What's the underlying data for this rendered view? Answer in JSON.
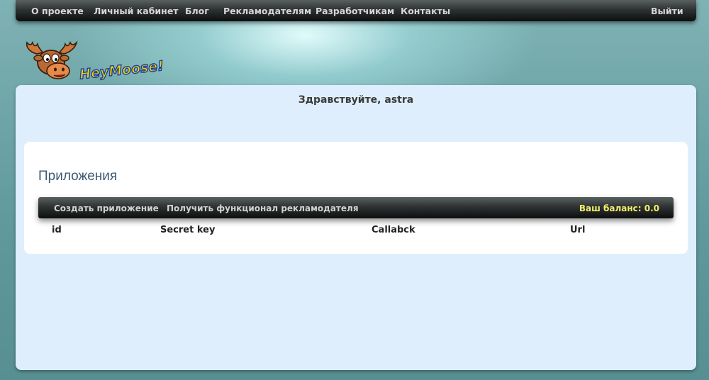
{
  "topnav": {
    "items": [
      "О проекте",
      "Личный кабинет",
      "Блог",
      "Рекламодателям",
      "Разработчикам",
      "Контакты"
    ],
    "logout": "Выйти"
  },
  "logo": {
    "text": "HeyMoose!"
  },
  "greeting": "Здравствуйте, astra",
  "apps": {
    "title": "Приложения",
    "toolbar": {
      "create": "Создать приложение",
      "advertiser": "Получить функционал рекламодателя",
      "balance": "Ваш баланс: 0.0"
    },
    "columns": [
      "id",
      "Secret key",
      "Callabck",
      "Url"
    ]
  },
  "colors": {
    "panel": "#deeefc",
    "card": "#ffffff",
    "title": "#3c5a72",
    "balance": "#f4f06a"
  }
}
